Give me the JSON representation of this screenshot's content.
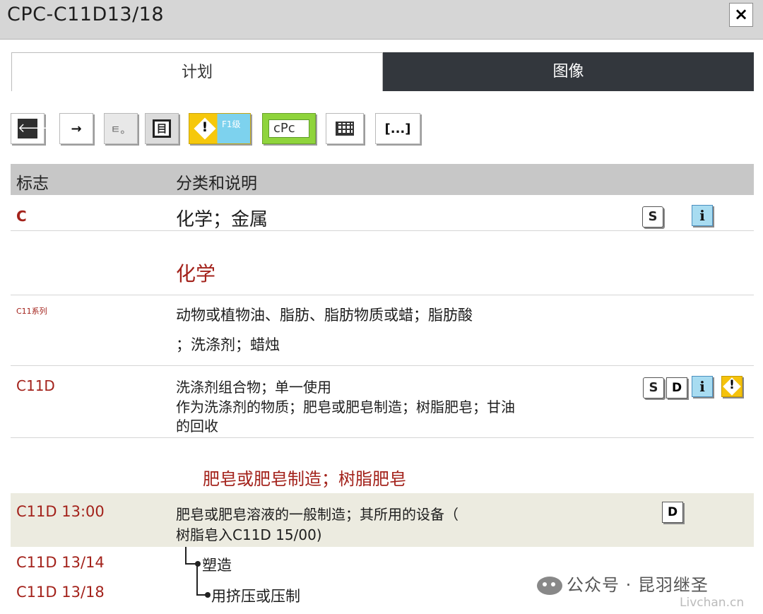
{
  "window": {
    "title": "CPC-C11D13/18",
    "close_label": "×"
  },
  "tabs": [
    {
      "label": "计划",
      "active": true
    },
    {
      "label": "图像",
      "active": false
    }
  ],
  "toolbar": {
    "back_icon": "🡐",
    "forward_icon": "→",
    "note_label": "ㅌ。",
    "tree_label": "目",
    "warning_level_label": "F1级",
    "cpc_label": "cPc",
    "more_label": "[...]"
  },
  "header": {
    "flag": "标志",
    "description": "分类和说明"
  },
  "rows": [
    {
      "symbol": "C",
      "description": "化学；金属",
      "icons": [
        "S",
        "i"
      ]
    },
    {
      "symbol": "",
      "description": "化学"
    },
    {
      "symbol": "C11系列",
      "description_line1": "动物或植物油、脂肪、脂肪物质或蜡；脂肪酸",
      "description_line2": "；洗涤剂；蜡烛"
    },
    {
      "symbol": "C11D",
      "description_line1": "洗涤剂组合物；单一使用",
      "description_line2": "作为洗涤剂的物质；肥皂或肥皂制造；树脂肥皂；甘油",
      "description_line3": "的回收",
      "icons": [
        "S",
        "D",
        "i",
        "!"
      ]
    },
    {
      "symbol": "",
      "description": "肥皂或肥皂制造；树脂肥皂"
    },
    {
      "symbol": "C11D 13:00",
      "description_line1": "肥皂或肥皂溶液的一般制造；其所用的设备（",
      "description_line2": "树脂皂入C11D 15/00)",
      "icons": [
        "D"
      ]
    },
    {
      "symbol": "C11D 13/14",
      "description": "塑造"
    },
    {
      "symbol": "C11D 13/18",
      "description": "用挤压或压制"
    }
  ],
  "watermark": {
    "text": "公众号 · 昆羽继圣",
    "site": "Livchan.cn"
  },
  "colors": {
    "symbol_red": "#a3221b",
    "header_gray": "#c7c7c7",
    "tab_dark": "#33373d",
    "highlight_row": "#ecebe0"
  }
}
